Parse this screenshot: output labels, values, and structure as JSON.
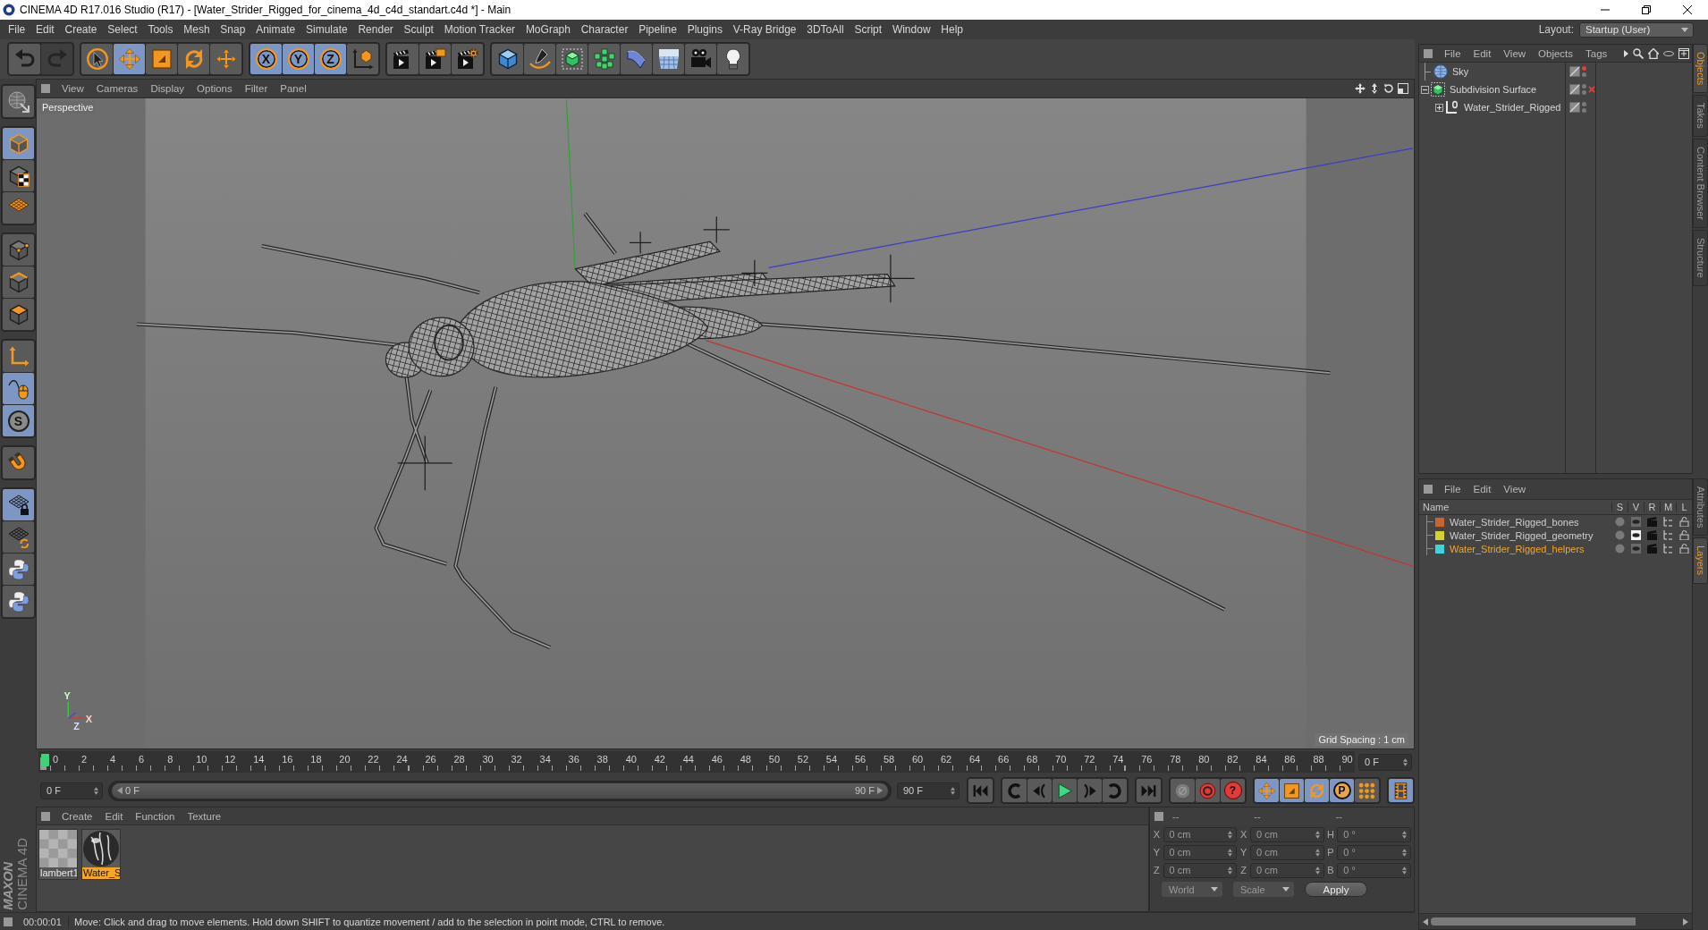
{
  "window": {
    "title": "CINEMA 4D R17.016 Studio (R17) - [Water_Strider_Rigged_for_cinema_4d_c4d_standart.c4d *] - Main"
  },
  "menu": [
    "File",
    "Edit",
    "Create",
    "Select",
    "Tools",
    "Mesh",
    "Snap",
    "Animate",
    "Simulate",
    "Render",
    "Sculpt",
    "Motion Tracker",
    "MoGraph",
    "Character",
    "Pipeline",
    "Plugins",
    "V-Ray Bridge",
    "3DToAll",
    "Script",
    "Window",
    "Help"
  ],
  "layout": {
    "label": "Layout:",
    "value": "Startup (User)"
  },
  "toolbar": [
    {
      "items": [
        {
          "kind": "undo",
          "selected": false,
          "disabled": false
        },
        {
          "kind": "redo",
          "selected": false,
          "disabled": true
        }
      ]
    },
    {
      "items": [
        {
          "kind": "select",
          "selected": false
        },
        {
          "kind": "move",
          "selected": true
        },
        {
          "kind": "scale",
          "selected": false
        },
        {
          "kind": "rotate",
          "selected": false
        },
        {
          "kind": "transform",
          "selected": false
        }
      ]
    },
    {
      "items": [
        {
          "kind": "axis-lock",
          "label": "X",
          "selected": true
        },
        {
          "kind": "axis-lock",
          "label": "Y",
          "selected": true
        },
        {
          "kind": "axis-lock",
          "label": "Z",
          "selected": true
        },
        {
          "kind": "coordinate-system",
          "selected": false
        }
      ]
    },
    {
      "items": [
        {
          "kind": "render-view",
          "selected": false
        },
        {
          "kind": "render-picture",
          "selected": false
        },
        {
          "kind": "render-settings",
          "selected": false
        }
      ]
    },
    {
      "items": [
        {
          "kind": "cube",
          "selected": false
        },
        {
          "kind": "pen",
          "selected": false
        },
        {
          "kind": "subdivision",
          "selected": false
        },
        {
          "kind": "cloner",
          "selected": false
        },
        {
          "kind": "deformer",
          "selected": false
        },
        {
          "kind": "floor",
          "selected": false
        },
        {
          "kind": "camera",
          "selected": false
        },
        {
          "kind": "light",
          "selected": false
        }
      ]
    }
  ],
  "left_toolbar": [
    {
      "items": [
        {
          "kind": "make-editable",
          "selected": false
        }
      ]
    },
    {
      "items": [
        {
          "kind": "model",
          "selected": true
        },
        {
          "kind": "texture",
          "selected": false
        },
        {
          "kind": "workplane",
          "selected": false
        }
      ]
    },
    {
      "items": [
        {
          "kind": "points",
          "selected": false
        },
        {
          "kind": "edges",
          "selected": false
        },
        {
          "kind": "polygons",
          "selected": false
        }
      ]
    },
    {
      "items": [
        {
          "kind": "axis",
          "selected": false
        },
        {
          "kind": "tweak",
          "selected": true
        },
        {
          "kind": "snap",
          "label": "S",
          "selected": true
        }
      ]
    },
    {
      "items": [
        {
          "kind": "magnet",
          "selected": false
        }
      ]
    },
    {
      "items": [
        {
          "kind": "lock-grid",
          "selected": true
        },
        {
          "kind": "grid-rotate",
          "selected": false
        },
        {
          "kind": "python",
          "selected": false
        },
        {
          "kind": "python",
          "selected": false
        }
      ]
    }
  ],
  "viewport": {
    "menu": [
      "View",
      "Cameras",
      "Display",
      "Options",
      "Filter",
      "Panel"
    ],
    "camera": "Perspective",
    "grid_spacing": "Grid Spacing : 1 cm",
    "axis_labels": [
      "Y",
      "X",
      "Z"
    ]
  },
  "timeline": {
    "frames": [
      "0",
      "2",
      "4",
      "6",
      "8",
      "10",
      "12",
      "14",
      "16",
      "18",
      "20",
      "22",
      "24",
      "26",
      "28",
      "30",
      "32",
      "34",
      "36",
      "38",
      "40",
      "42",
      "44",
      "46",
      "48",
      "50",
      "52",
      "54",
      "56",
      "58",
      "60",
      "62",
      "64",
      "66",
      "68",
      "70",
      "72",
      "74",
      "76",
      "78",
      "80",
      "82",
      "84",
      "86",
      "88",
      "90"
    ],
    "current": "0 F",
    "start": "0 F",
    "range": {
      "start": "0 F",
      "end": "90 F",
      "level": 1
    },
    "end": "90 F",
    "controls": [
      {
        "items": [
          {
            "kind": "to-start",
            "selected": false
          }
        ]
      },
      {
        "items": [
          {
            "kind": "prev-key",
            "selected": false
          },
          {
            "kind": "prev-frame",
            "selected": false
          },
          {
            "kind": "play",
            "selected": false
          },
          {
            "kind": "next-frame",
            "selected": false
          },
          {
            "kind": "next-key",
            "selected": false
          }
        ]
      },
      {
        "items": [
          {
            "kind": "to-end",
            "selected": false
          }
        ]
      },
      {
        "items": [
          {
            "kind": "record",
            "selected": false
          },
          {
            "kind": "autokey",
            "selected": false
          },
          {
            "kind": "help",
            "label": "?",
            "selected": false
          }
        ]
      },
      {
        "items": [
          {
            "kind": "key-move",
            "selected": true
          },
          {
            "kind": "key-scale",
            "selected": true
          },
          {
            "kind": "key-rotate",
            "selected": true
          },
          {
            "kind": "key-param",
            "label": "P",
            "selected": true
          },
          {
            "kind": "key-points",
            "selected": false
          }
        ]
      },
      {
        "items": [
          {
            "kind": "film",
            "selected": true
          }
        ]
      }
    ]
  },
  "materials": {
    "menu": [
      "Create",
      "Edit",
      "Function",
      "Texture"
    ],
    "items": [
      {
        "name": "lambert1",
        "kind": "flat",
        "selected": false
      },
      {
        "name": "Water_S",
        "kind": "sphere",
        "selected": true
      }
    ]
  },
  "coordinates": {
    "disabled": true,
    "headers": [
      "--",
      "--",
      "--"
    ],
    "rows": [
      [
        {
          "axis": "X",
          "value": "0 cm"
        },
        {
          "axis": "X",
          "value": "0 cm"
        },
        {
          "axis": "H",
          "value": "0 °"
        }
      ],
      [
        {
          "axis": "Y",
          "value": "0 cm"
        },
        {
          "axis": "Y",
          "value": "0 cm"
        },
        {
          "axis": "P",
          "value": "0 °"
        }
      ],
      [
        {
          "axis": "Z",
          "value": "0 cm"
        },
        {
          "axis": "Z",
          "value": "0 cm"
        },
        {
          "axis": "B",
          "value": "0 °"
        }
      ]
    ],
    "dropdowns": [
      "World",
      "Scale"
    ],
    "apply": "Apply"
  },
  "status_bar": {
    "time": "00:00:01",
    "message": "Move: Click and drag to move elements. Hold down SHIFT to quantize movement / add to the selection in point mode, CTRL to remove."
  },
  "objects": {
    "menu": [
      "File",
      "Edit",
      "View",
      "Objects",
      "Tags"
    ],
    "tree": [
      {
        "name": "Sky",
        "kind": "sky",
        "editor_visible": false
      },
      {
        "name": "Subdivision Surface",
        "kind": "subdivision",
        "expanded": true,
        "editor_visible": true,
        "enabled": false,
        "children": [
          {
            "name": "Water_Strider_Rigged",
            "kind": "null",
            "expanded": false,
            "editor_visible": true
          }
        ]
      }
    ]
  },
  "layers": {
    "menu": [
      "File",
      "Edit",
      "View"
    ],
    "columns": [
      "Name",
      "S",
      "V",
      "R",
      "M",
      "L"
    ],
    "rows": [
      {
        "name": "Water_Strider_Rigged_bones",
        "color": "#c8652c",
        "selected": false,
        "view_highlight": false
      },
      {
        "name": "Water_Strider_Rigged_geometry",
        "color": "#d6d32c",
        "selected": false,
        "view_highlight": true
      },
      {
        "name": "Water_Strider_Rigged_helpers",
        "color": "#3dd5dc",
        "selected": true,
        "view_highlight": false
      }
    ]
  },
  "dock_tabs": {
    "top": [
      {
        "label": "Objects",
        "selected": true
      },
      {
        "label": "Takes",
        "selected": false
      },
      {
        "label": "Content Browser",
        "selected": false
      },
      {
        "label": "Structure",
        "selected": false
      }
    ],
    "bottom": [
      {
        "label": "Attributes",
        "selected": false
      },
      {
        "label": "Layers",
        "selected": true
      }
    ]
  },
  "brand": {
    "maker": "MAXON",
    "product": "CINEMA 4D"
  }
}
